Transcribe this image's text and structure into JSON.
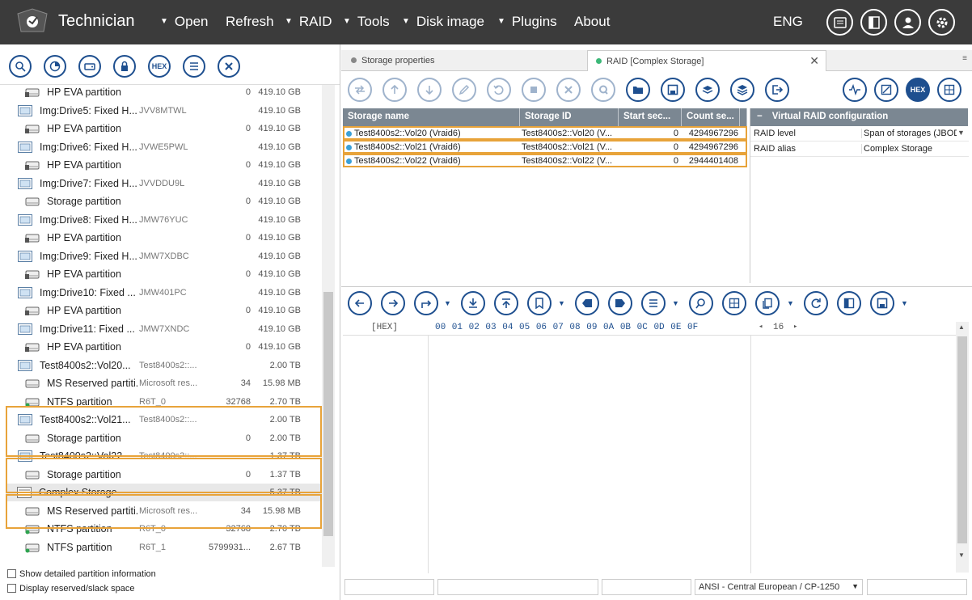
{
  "app": {
    "title": "Technician"
  },
  "menu": {
    "items": [
      {
        "label": "Open",
        "has_arrow": true
      },
      {
        "label": "Refresh",
        "has_arrow": false
      },
      {
        "label": "RAID",
        "has_arrow": true
      },
      {
        "label": "Tools",
        "has_arrow": true
      },
      {
        "label": "Disk image",
        "has_arrow": true
      },
      {
        "label": "Plugins",
        "has_arrow": true
      },
      {
        "label": "About",
        "has_arrow": false
      }
    ],
    "language": "ENG"
  },
  "left_toolbar": {
    "hex_label": "HEX"
  },
  "tree": {
    "rows": [
      {
        "type": "partition",
        "name": "HP EVA partition",
        "id": "",
        "num": "0",
        "size": "419.10 GB"
      },
      {
        "type": "drive",
        "name": "Img:Drive5: Fixed H...",
        "id": "JVV8MTWL",
        "num": "",
        "size": "419.10 GB"
      },
      {
        "type": "partition",
        "name": "HP EVA partition",
        "id": "",
        "num": "0",
        "size": "419.10 GB"
      },
      {
        "type": "drive",
        "name": "Img:Drive6: Fixed H...",
        "id": "JVWE5PWL",
        "num": "",
        "size": "419.10 GB"
      },
      {
        "type": "partition",
        "name": "HP EVA partition",
        "id": "",
        "num": "0",
        "size": "419.10 GB"
      },
      {
        "type": "drive",
        "name": "Img:Drive7: Fixed H...",
        "id": "JVVDDU9L",
        "num": "",
        "size": "419.10 GB"
      },
      {
        "type": "partition-plain",
        "name": "Storage partition",
        "id": "",
        "num": "0",
        "size": "419.10 GB"
      },
      {
        "type": "drive",
        "name": "Img:Drive8: Fixed H...",
        "id": "JMW76YUC",
        "num": "",
        "size": "419.10 GB"
      },
      {
        "type": "partition",
        "name": "HP EVA partition",
        "id": "",
        "num": "0",
        "size": "419.10 GB"
      },
      {
        "type": "drive",
        "name": "Img:Drive9: Fixed H...",
        "id": "JMW7XDBC",
        "num": "",
        "size": "419.10 GB"
      },
      {
        "type": "partition",
        "name": "HP EVA partition",
        "id": "",
        "num": "0",
        "size": "419.10 GB"
      },
      {
        "type": "drive",
        "name": "Img:Drive10: Fixed ...",
        "id": "JMW401PC",
        "num": "",
        "size": "419.10 GB"
      },
      {
        "type": "partition",
        "name": "HP EVA partition",
        "id": "",
        "num": "0",
        "size": "419.10 GB"
      },
      {
        "type": "drive",
        "name": "Img:Drive11: Fixed ...",
        "id": "JMW7XNDC",
        "num": "",
        "size": "419.10 GB"
      },
      {
        "type": "partition",
        "name": "HP EVA partition",
        "id": "",
        "num": "0",
        "size": "419.10 GB"
      },
      {
        "type": "drive",
        "name": "Test8400s2::Vol20...",
        "id": "Test8400s2::...",
        "num": "",
        "size": "2.00 TB"
      },
      {
        "type": "partition-plain",
        "name": "MS Reserved partiti...",
        "id": "Microsoft res...",
        "num": "34",
        "size": "15.98 MB"
      },
      {
        "type": "partition-ntfs",
        "name": "NTFS partition",
        "id": "R6T_0",
        "num": "32768",
        "size": "2.70 TB"
      },
      {
        "type": "drive",
        "name": "Test8400s2::Vol21...",
        "id": "Test8400s2::...",
        "num": "",
        "size": "2.00 TB"
      },
      {
        "type": "partition-plain",
        "name": "Storage partition",
        "id": "",
        "num": "0",
        "size": "2.00 TB"
      },
      {
        "type": "drive",
        "name": "Test8400s2::Vol22...",
        "id": "Test8400s2::...",
        "num": "",
        "size": "1.37 TB"
      },
      {
        "type": "partition-plain",
        "name": "Storage partition",
        "id": "",
        "num": "0",
        "size": "1.37 TB"
      },
      {
        "type": "raid",
        "name": "Complex Storage",
        "id": "",
        "num": "",
        "size": "5.37 TB"
      },
      {
        "type": "partition-plain",
        "name": "MS Reserved partiti...",
        "id": "Microsoft res...",
        "num": "34",
        "size": "15.98 MB"
      },
      {
        "type": "partition-ntfs",
        "name": "NTFS partition",
        "id": "R6T_0",
        "num": "32768",
        "size": "2.70 TB"
      },
      {
        "type": "partition-ntfs",
        "name": "NTFS partition",
        "id": "R6T_1",
        "num": "5799931...",
        "size": "2.67 TB"
      }
    ]
  },
  "options": {
    "detailed": "Show detailed partition information",
    "reserved": "Display reserved/slack space"
  },
  "tabs": [
    {
      "label": "Storage properties",
      "active": false
    },
    {
      "label": "RAID [Complex Storage]",
      "active": true
    }
  ],
  "right_toolbar": {
    "hex_label": "HEX"
  },
  "storage_table": {
    "headers": [
      "Storage name",
      "Storage ID",
      "Start sec...",
      "Count se..."
    ],
    "rows": [
      [
        "Test8400s2::Vol20 (Vraid6)",
        "Test8400s2::Vol20 (V...",
        "0",
        "4294967296"
      ],
      [
        "Test8400s2::Vol21 (Vraid6)",
        "Test8400s2::Vol21 (V...",
        "0",
        "4294967296"
      ],
      [
        "Test8400s2::Vol22 (Vraid6)",
        "Test8400s2::Vol22 (V...",
        "0",
        "2944401408"
      ]
    ]
  },
  "vraid": {
    "collapse": "−",
    "title": "Virtual RAID configuration",
    "rows": [
      {
        "key": "RAID level",
        "value": "Span of storages (JBOD)"
      },
      {
        "key": "RAID alias",
        "value": "Complex Storage"
      }
    ]
  },
  "hex": {
    "label": "[HEX]",
    "columns": "00 01 02 03 04 05 06 07 08 09 0A 0B 0C 0D 0E 0F",
    "width": "16"
  },
  "status": {
    "encoding": "ANSI - Central European / CP-1250"
  },
  "colors": {
    "accent": "#1e4f8f",
    "highlight": "#e8a33a",
    "topbar": "#3b3b3b",
    "table_header": "#7b8792"
  }
}
